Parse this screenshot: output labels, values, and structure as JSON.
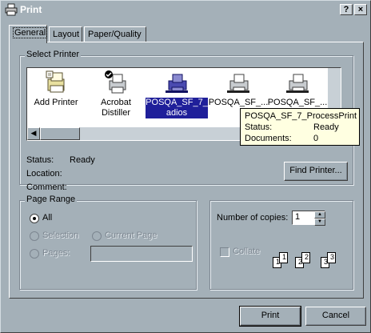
{
  "window": {
    "title": "Print"
  },
  "titlebar": {
    "help_label": "?",
    "close_label": "×"
  },
  "tabs": [
    {
      "label": "General",
      "active": true
    },
    {
      "label": "Layout",
      "active": false
    },
    {
      "label": "Paper/Quality",
      "active": false
    }
  ],
  "select_printer": {
    "group_label": "Select Printer",
    "printers": [
      {
        "label_line1": "Add Printer",
        "label_line2": "",
        "icon": "add-printer-icon"
      },
      {
        "label_line1": "Acrobat",
        "label_line2": "Distiller",
        "icon": "default-printer-icon"
      },
      {
        "label_line1": "POSQA_SF_7_",
        "label_line2": "adios",
        "icon": "network-printer-icon",
        "selected": true
      },
      {
        "label_line1": "POSQA_SF_...",
        "label_line2": "",
        "icon": "network-printer-icon"
      },
      {
        "label_line1": "POSQA_SF_...",
        "label_line2": "",
        "icon": "network-printer-icon"
      }
    ],
    "status_label": "Status:",
    "status_value": "Ready",
    "location_label": "Location:",
    "location_value": "",
    "comment_label": "Comment:",
    "comment_value": "",
    "find_printer_label": "Find Printer..."
  },
  "tooltip": {
    "name": "POSQA_SF_7_ProcessPrint",
    "status_label": "Status:",
    "status_value": "Ready",
    "documents_label": "Documents:",
    "documents_value": "0"
  },
  "page_range": {
    "group_label": "Page Range",
    "all_label": "All",
    "selection_label": "Selection",
    "current_page_label": "Current Page",
    "pages_label": "Pages:",
    "pages_value": "",
    "selected": "All"
  },
  "copies": {
    "number_label": "Number of copies:",
    "number_value": "1",
    "collate_label": "Collate",
    "collate_checked": false,
    "collate_pages": [
      "1",
      "1",
      "2",
      "2",
      "3",
      "3"
    ]
  },
  "buttons": {
    "print_label": "Print",
    "cancel_label": "Cancel"
  }
}
